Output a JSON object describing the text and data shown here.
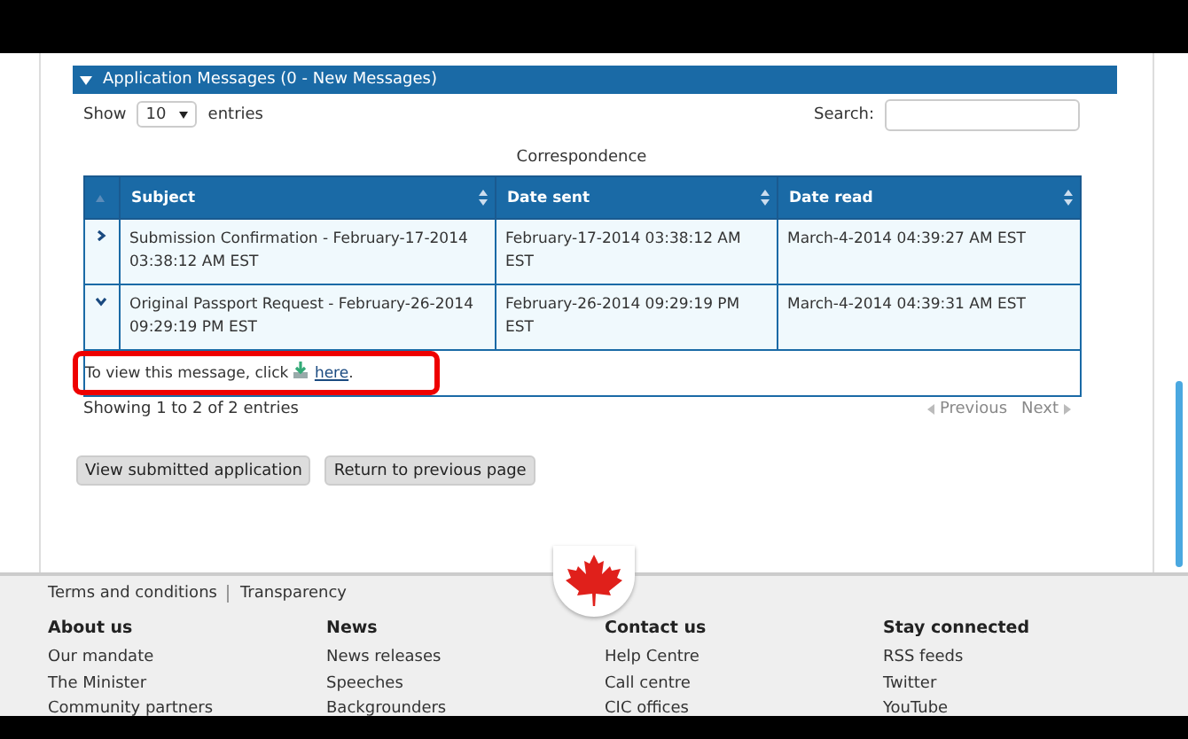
{
  "section": {
    "title": "Application Messages (0 - New Messages)",
    "expanded": true
  },
  "length_control": {
    "before": "Show",
    "value": "10",
    "after": "entries"
  },
  "search": {
    "label": "Search:"
  },
  "table": {
    "caption": "Correspondence",
    "columns": [
      {
        "label": "Subject"
      },
      {
        "label": "Date sent"
      },
      {
        "label": "Date read"
      }
    ],
    "rows": [
      {
        "expanded": false,
        "cells": [
          "Submission Confirmation - February-17-2014 03:38:12 AM EST",
          "February-17-2014 03:38:12 AM EST",
          "March-4-2014 04:39:27 AM EST"
        ]
      },
      {
        "expanded": true,
        "cells": [
          "Original Passport Request - February-26-2014 09:29:19 PM EST",
          "February-26-2014 09:29:19 PM EST",
          "March-4-2014 04:39:31 AM EST"
        ],
        "detail": {
          "before": "To view this message, click",
          "link": "here",
          "after": "."
        }
      }
    ]
  },
  "info": "Showing 1 to 2 of 2 entries",
  "pagination": [
    {
      "label": "Previous",
      "disabled": true
    },
    {
      "label": "Next",
      "disabled": true
    }
  ],
  "buttons": [
    "View submitted application",
    "Return to previous page"
  ],
  "footer": {
    "top_links": [
      "Terms and conditions",
      "Transparency"
    ],
    "columns": [
      {
        "heading": "About us",
        "links": [
          "Our mandate",
          "The Minister",
          "Community partners"
        ]
      },
      {
        "heading": "News",
        "links": [
          "News releases",
          "Speeches",
          "Backgrounders"
        ]
      },
      {
        "heading": "Contact us",
        "links": [
          "Help Centre",
          "Call centre",
          "CIC offices"
        ]
      },
      {
        "heading": "Stay connected",
        "links": [
          "RSS feeds",
          "Twitter",
          "YouTube"
        ]
      }
    ]
  }
}
